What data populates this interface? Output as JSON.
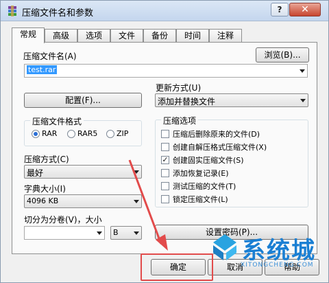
{
  "window": {
    "title": "压缩文件名和参数",
    "help_glyph": "?",
    "close_glyph": "✕"
  },
  "tabs": [
    {
      "label": "常规",
      "active": true
    },
    {
      "label": "高级"
    },
    {
      "label": "选项"
    },
    {
      "label": "文件"
    },
    {
      "label": "备份"
    },
    {
      "label": "时间"
    },
    {
      "label": "注释"
    }
  ],
  "general": {
    "archive_name_label": "压缩文件名(A)",
    "browse_label": "浏览(B)...",
    "archive_name_value": "test.rar",
    "profiles_label": "配置(F)...",
    "update_mode_label": "更新方式(U)",
    "update_mode_value": "添加并替换文件",
    "format_group_title": "压缩文件格式",
    "formats": [
      {
        "label": "RAR",
        "selected": true
      },
      {
        "label": "RAR5",
        "selected": false
      },
      {
        "label": "ZIP",
        "selected": false
      }
    ],
    "compression_method_label": "压缩方式(C)",
    "compression_method_value": "最好",
    "dictionary_label": "字典大小(I)",
    "dictionary_value": "4096 KB",
    "split_label": "切分为分卷(V)，大小",
    "split_unit_value": "B",
    "options_group_title": "压缩选项",
    "options": [
      {
        "label": "压缩后删除原来的文件(D)",
        "checked": false
      },
      {
        "label": "创建自解压格式压缩文件(X)",
        "checked": false
      },
      {
        "label": "创建固实压缩文件(S)",
        "checked": true
      },
      {
        "label": "添加恢复记录(E)",
        "checked": false
      },
      {
        "label": "测试压缩的文件(T)",
        "checked": false
      },
      {
        "label": "锁定压缩文件(L)",
        "checked": false
      }
    ],
    "password_button": "设置密码(P)..."
  },
  "footer": {
    "ok_label": "确定",
    "cancel_label": "取消",
    "help_label": "帮助"
  },
  "watermark": {
    "text": "系统城",
    "url": "XITONGCHENG.COM"
  },
  "colors": {
    "title_gradient_top": "#dbe7f5",
    "close_red": "#c7452f",
    "annotation_red": "#e24b4b",
    "selection_blue": "#3399ff",
    "watermark_blue": "#1a7fd3"
  }
}
